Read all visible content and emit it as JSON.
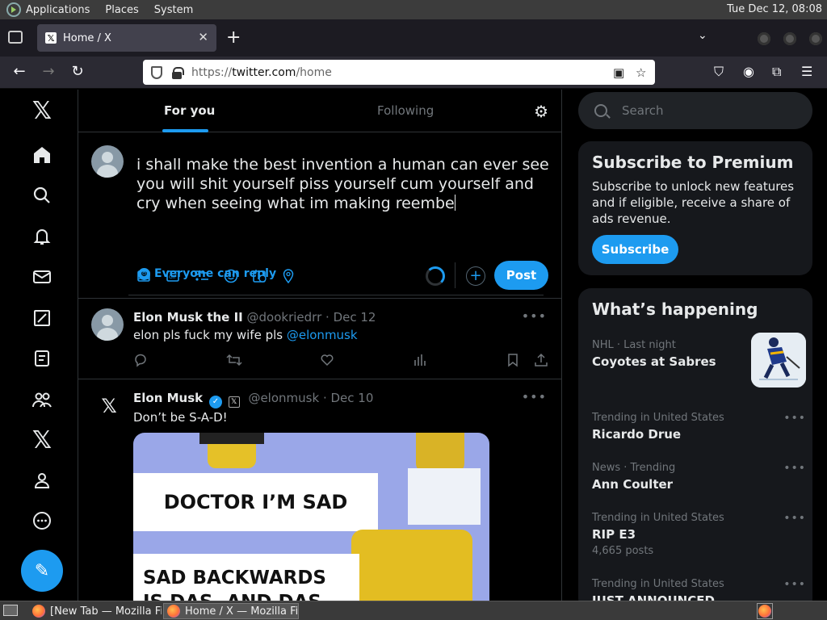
{
  "desktop": {
    "menus": [
      "Applications",
      "Places",
      "System"
    ],
    "clock": "Tue Dec 12, 08:08"
  },
  "browser": {
    "tab_title": "Home / X",
    "url_proto": "https://",
    "url_host": "twitter.com",
    "url_path": "/home"
  },
  "timeline_tabs": {
    "for_you": "For you",
    "following": "Following"
  },
  "composer": {
    "draft_text": "i shall make the best invention a human can ever see you will shit yourself piss yourself cum yourself and cry when seeing what im making reembe",
    "reply_setting": "Everyone can reply",
    "post_label": "Post",
    "add_thread": "+"
  },
  "tweets": [
    {
      "name": "Elon Musk the II",
      "handle": "@dookriedrr",
      "date": "Dec 12",
      "text": "elon pls fuck my wife pls ",
      "mention": "@elonmusk"
    },
    {
      "name": "Elon Musk",
      "handle": "@elonmusk",
      "date": "Dec 10",
      "text": "Don’t be S-A-D!",
      "media_caption_1": "DOCTOR I’M SAD",
      "media_caption_2": "SAD BACKWARDS",
      "media_caption_3": "IS DAS, AND DAS"
    }
  ],
  "sidebar": {
    "search_placeholder": "Search",
    "premium": {
      "title": "Subscribe to Premium",
      "description": "Subscribe to unlock new features and if eligible, receive a share of ads revenue.",
      "button": "Subscribe"
    },
    "whats_happening": {
      "title": "What’s happening",
      "trends": [
        {
          "context": "NHL · Last night",
          "title": "Coyotes at Sabres",
          "count": ""
        },
        {
          "context": "Trending in United States",
          "title": "Ricardo Drue",
          "count": ""
        },
        {
          "context": "News · Trending",
          "title": "Ann Coulter",
          "count": ""
        },
        {
          "context": "Trending in United States",
          "title": "RIP E3",
          "count": "4,665 posts"
        },
        {
          "context": "Trending in United States",
          "title": "JUST ANNOUNCED",
          "count": ""
        }
      ]
    }
  },
  "taskbar": {
    "tasks": [
      "[New Tab — Mozilla Firefox]",
      "Home / X — Mozilla Firefox"
    ]
  },
  "colors": {
    "accent": "#1d9bf0",
    "background": "#000000",
    "card": "#16181c",
    "muted": "#71767b"
  },
  "icons": [
    "x-logo-icon",
    "home-icon",
    "explore-icon",
    "notifications-icon",
    "messages-icon",
    "grok-icon",
    "lists-icon",
    "communities-icon",
    "premium-icon",
    "profile-icon",
    "more-icon",
    "compose-icon"
  ]
}
